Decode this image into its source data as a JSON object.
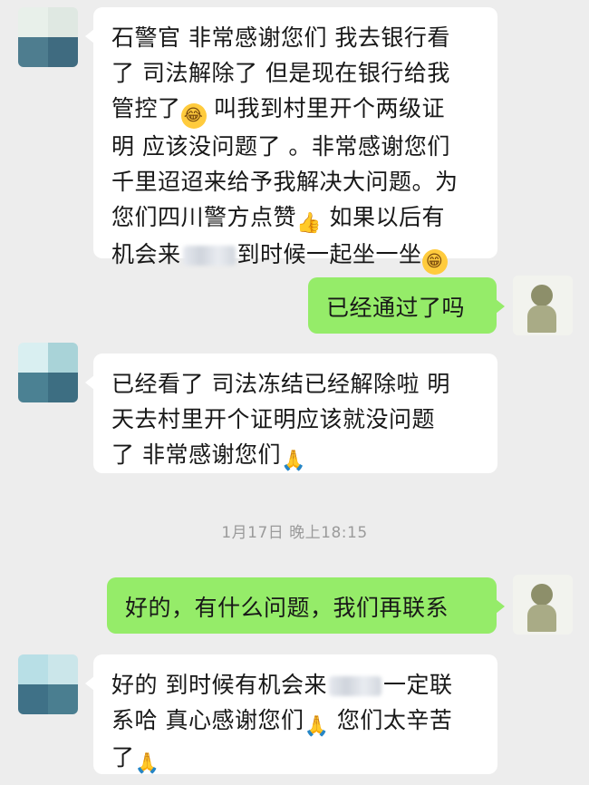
{
  "messages": [
    {
      "side": "in",
      "line1": "石警官 非常感谢您们 我去银行看",
      "line2": "了 司法解除了 但是现在银行给我",
      "line3a": "管控了",
      "line3b": " 叫我到村里开个两级证",
      "line4": "明 应该没问题了 。非常感谢您们",
      "line5": "千里迢迢来给予我解决大问题。为",
      "line6a": "您们四川警方点赞",
      "line6b": " 如果以后有",
      "line7a": "机会来",
      "line7b": "到时候一起坐一坐"
    },
    {
      "side": "out",
      "text": "已经通过了吗"
    },
    {
      "side": "in",
      "line1": "已经看了 司法冻结已经解除啦 明",
      "line2": "天去村里开个证明应该就没问题",
      "line3": "了 非常感谢您们"
    },
    {
      "side": "out",
      "text": "好的，有什么问题，我们再联系"
    },
    {
      "side": "in",
      "line1a": "好的 到时候有机会来",
      "line1b": "一定联",
      "line2a": "系哈 真心感谢您们",
      "line2b": " 您们太辛苦",
      "line3": "了"
    }
  ],
  "timestamp": "1月17日 晚上18:15",
  "icons": {
    "crying_laughing": "😂",
    "thumbs_up": "👍",
    "grinning": "😁",
    "folded_hands": "🙏"
  },
  "colors": {
    "background": "#ededed",
    "incoming_bubble": "#ffffff",
    "outgoing_bubble": "#95ec69"
  }
}
